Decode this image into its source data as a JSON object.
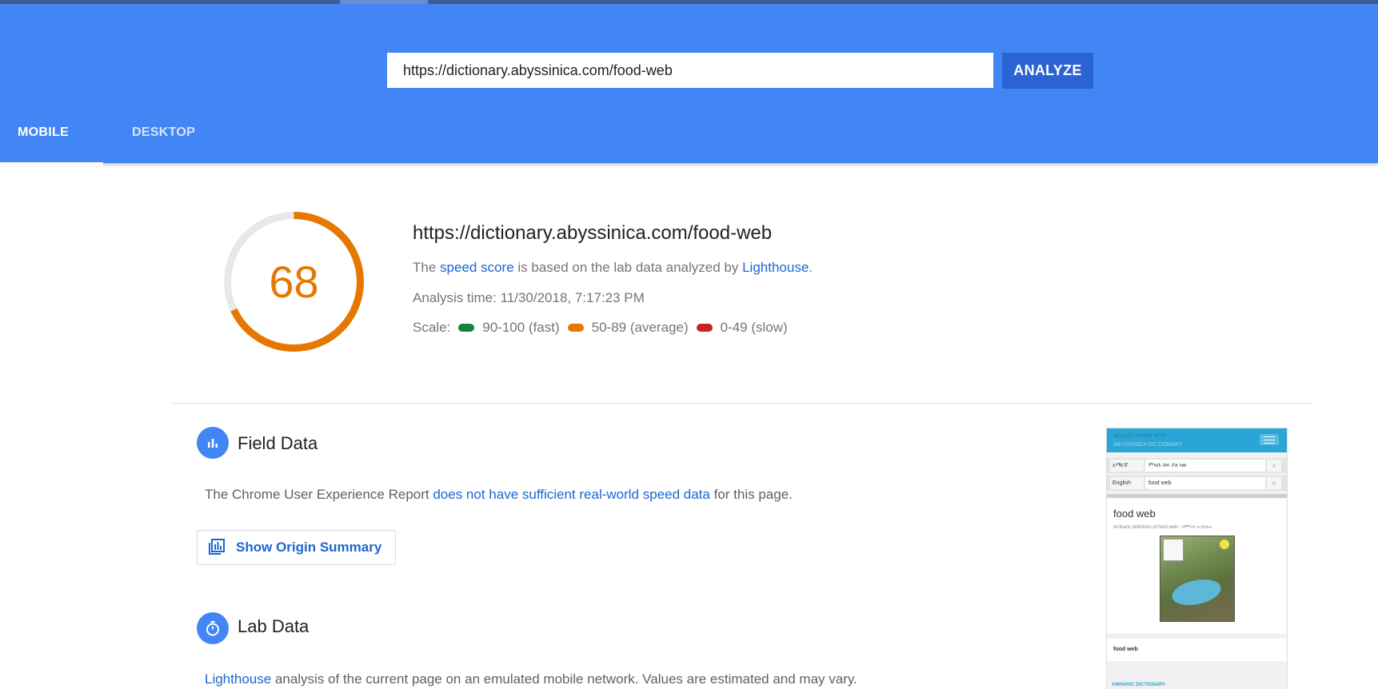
{
  "header": {
    "url_value": "https://dictionary.abyssinica.com/food-web",
    "analyze_label": "ANALYZE",
    "tabs": [
      {
        "label": "MOBILE",
        "active": true
      },
      {
        "label": "DESKTOP",
        "active": false
      }
    ],
    "colors": {
      "header_bg": "#4285f4",
      "button_bg": "#2a63d2"
    }
  },
  "summary": {
    "score": "68",
    "score_fraction": 0.68,
    "score_color": "#e67700",
    "url": "https://dictionary.abyssinica.com/food-web",
    "desc_prefix": "The ",
    "desc_link1": "speed score",
    "desc_mid": " is based on the lab data analyzed by ",
    "desc_link2": "Lighthouse",
    "desc_suffix": ".",
    "analysis_time": "Analysis time: 11/30/2018, 7:17:23 PM",
    "scale_label": "Scale:",
    "scale": [
      {
        "label": "90-100 (fast)",
        "color": "#178239"
      },
      {
        "label": "50-89 (average)",
        "color": "#e67700"
      },
      {
        "label": "0-49 (slow)",
        "color": "#c7221f"
      }
    ]
  },
  "field_data": {
    "title": "Field Data",
    "icon": "bar-chart-icon",
    "text_prefix": "The Chrome User Experience Report ",
    "text_link": "does not have sufficient real-world speed data",
    "text_suffix": " for this page.",
    "origin_button": "Show Origin Summary",
    "origin_icon": "library-chart-icon"
  },
  "lab_data": {
    "title": "Lab Data",
    "icon": "stopwatch-icon",
    "text_link": "Lighthouse",
    "text_rest": " analysis of the current page on an emulated mobile network. Values are estimated and may vary."
  },
  "thumbnail": {
    "site_title": "አቢሲኒካ መዝገበ ቃላት",
    "site_subtitle": "ABYSSINICA DICTIONARY",
    "row1_select": "አማርኛ",
    "row1_input": "ምላሱ ከፍ ያለ ነው",
    "row2_select": "English",
    "row2_input": "food web",
    "word": "food web",
    "definition_line": "Amharic definition of food web - የምግብ ሠንሰለት",
    "footer_word": "food web",
    "amharic_label": "AMHARIC DICTIONARY"
  }
}
